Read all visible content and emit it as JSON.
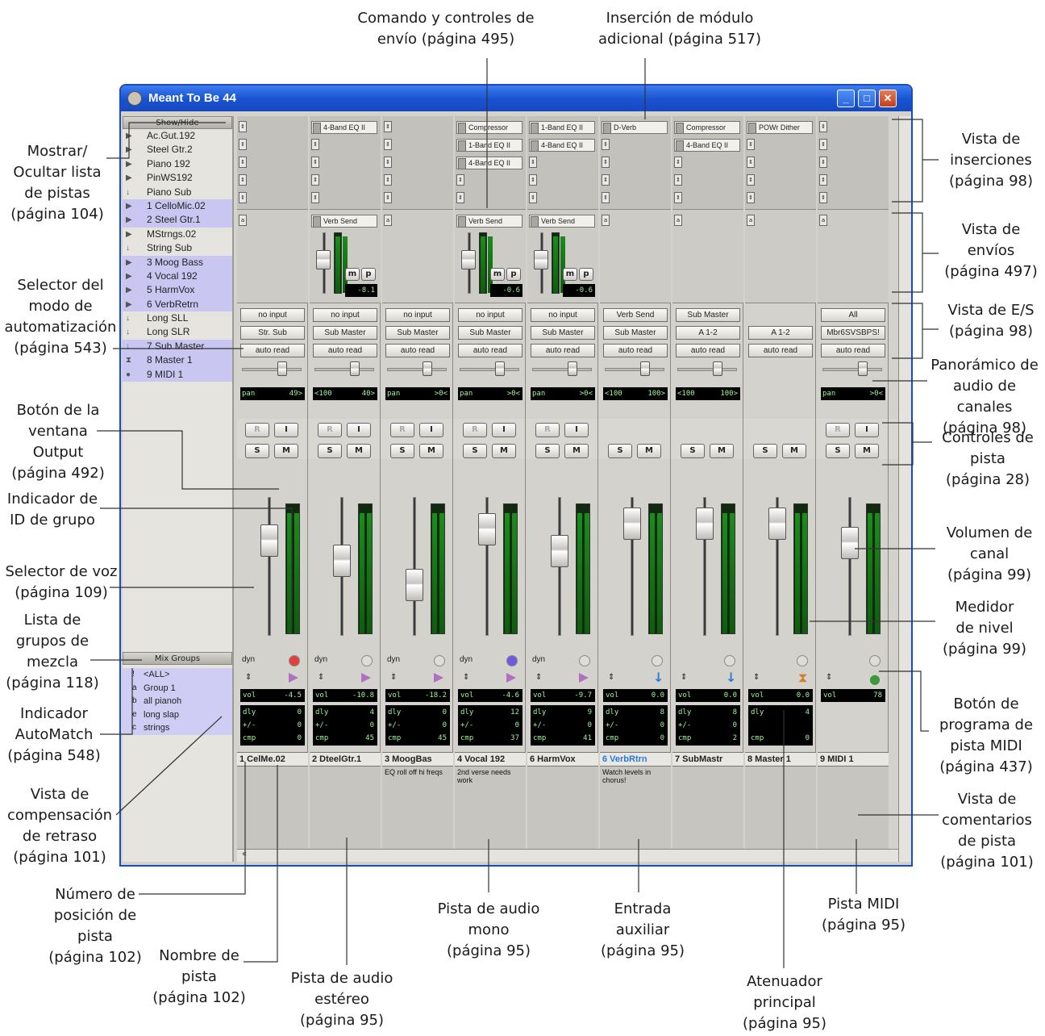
{
  "window": {
    "title": "Meant To Be 44"
  },
  "left_panel": {
    "show_hide_label": "Show/Hide",
    "tracks": [
      {
        "icon": "triangle",
        "name": "Ac.Gut.192",
        "selected": false
      },
      {
        "icon": "triangle",
        "name": "Steel Gtr.2",
        "selected": false
      },
      {
        "icon": "triangle",
        "name": "Piano 192",
        "selected": false
      },
      {
        "icon": "triangle",
        "name": "PinWS192",
        "selected": false
      },
      {
        "icon": "arrow",
        "name": "Piano Sub",
        "selected": false
      },
      {
        "icon": "triangle",
        "name": "1 CelloMic.02",
        "selected": true
      },
      {
        "icon": "triangle",
        "name": "2 Steel Gtr.1",
        "selected": true
      },
      {
        "icon": "triangle",
        "name": "MStrngs.02",
        "selected": false
      },
      {
        "icon": "arrow",
        "name": "String Sub",
        "selected": false
      },
      {
        "icon": "triangle",
        "name": "3 Moog Bass",
        "selected": true
      },
      {
        "icon": "triangle",
        "name": "4 Vocal 192",
        "selected": true
      },
      {
        "icon": "triangle",
        "name": "5 HarmVox",
        "selected": true
      },
      {
        "icon": "triangle",
        "name": "6 VerbRetrn",
        "selected": true
      },
      {
        "icon": "arrow",
        "name": "Long SLL",
        "selected": false
      },
      {
        "icon": "arrow",
        "name": "Long SLR",
        "selected": false
      },
      {
        "icon": "arrow",
        "name": "7 Sub Master",
        "selected": true
      },
      {
        "icon": "master",
        "name": "8 Master 1",
        "selected": true
      },
      {
        "icon": "midi",
        "name": "9 MIDI 1",
        "selected": true
      }
    ],
    "mix_groups_label": "Mix Groups",
    "groups": [
      {
        "letter": "!",
        "name": "<ALL>"
      },
      {
        "letter": "a",
        "name": "Group 1"
      },
      {
        "letter": "b",
        "name": "all pianoh"
      },
      {
        "letter": "e",
        "name": "long slap"
      },
      {
        "letter": "c",
        "name": "strings"
      }
    ]
  },
  "strips": [
    {
      "name": "1 CelMe.02",
      "inserts": [],
      "send": "",
      "send_value": "",
      "input": "no input",
      "output": "Str. Sub",
      "auto": "auto read",
      "pan_l": "pan",
      "pan_r": "49>",
      "rec": true,
      "vol": "-4.5",
      "dly": "0",
      "comp": "0",
      "cmp": "0",
      "comment": "",
      "dyn": "dyn",
      "voice": "red",
      "group_flag": "flag",
      "fader_pos": 0.3,
      "meter": 0.93
    },
    {
      "name": "2 DteelGtr.1",
      "inserts": [
        "4-Band EQ II"
      ],
      "send": "Verb Send",
      "send_value": "-8.1",
      "input": "no input",
      "output": "Sub Master",
      "auto": "auto read",
      "pan_l": "<100",
      "pan_r": "40>",
      "rec": true,
      "vol": "-10.8",
      "dly": "4",
      "comp": "0",
      "cmp": "45",
      "comment": "",
      "dyn": "dyn",
      "voice": "grey",
      "group_flag": "flag",
      "fader_pos": 0.45,
      "meter": 0.93
    },
    {
      "name": "3 MoogBas",
      "inserts": [],
      "send": "",
      "send_value": "",
      "input": "no input",
      "output": "Sub Master",
      "auto": "auto read",
      "pan_l": "pan",
      "pan_r": ">0<",
      "rec": true,
      "vol": "-18.2",
      "dly": "0",
      "comp": "0",
      "cmp": "45",
      "comment": "EQ roll off hi freqs",
      "dyn": "dyn",
      "voice": "grey",
      "group_flag": "flag",
      "fader_pos": 0.62,
      "meter": 0.93
    },
    {
      "name": "4 Vocal 192",
      "inserts": [
        "Compressor",
        "1-Band EQ II",
        "4-Band EQ II"
      ],
      "send": "Verb Send",
      "send_value": "-0.6",
      "input": "no input",
      "output": "Sub Master",
      "auto": "auto read",
      "pan_l": "pan",
      "pan_r": ">0<",
      "rec": true,
      "vol": "-4.6",
      "dly": "12",
      "comp": "0",
      "cmp": "37",
      "comment": "2nd verse needs work",
      "dyn": "dyn",
      "voice": "purple",
      "group_flag": "flag",
      "fader_pos": 0.22,
      "meter": 0.93
    },
    {
      "name": "6 HarmVox",
      "inserts": [
        "1-Band EQ II",
        "4-Band EQ II"
      ],
      "send": "Verb Send",
      "send_value": "-0.6",
      "input": "no input",
      "output": "Sub Master",
      "auto": "auto read",
      "pan_l": "pan",
      "pan_r": ">0<",
      "rec": true,
      "vol": "-9.7",
      "dly": "9",
      "comp": "0",
      "cmp": "41",
      "comment": "",
      "dyn": "dyn",
      "voice": "grey",
      "group_flag": "flag",
      "fader_pos": 0.38,
      "meter": 0.93
    },
    {
      "name": "6 VerbRtrn",
      "inserts": [
        "D-Verb"
      ],
      "send": "",
      "send_value": "",
      "input": "Verb Send",
      "output": "Sub Master",
      "auto": "auto read",
      "pan_l": "<100",
      "pan_r": "100>",
      "rec": false,
      "vol": "0.0",
      "dly": "8",
      "comp": "0",
      "cmp": "0",
      "comment": "Watch levels in chorus!",
      "dyn": "",
      "voice": "grey",
      "group_flag": "arrow",
      "fader_pos": 0.18,
      "meter": 0.93
    },
    {
      "name": "7 SubMastr",
      "inserts": [
        "Compressor",
        "4-Band EQ II"
      ],
      "send": "",
      "send_value": "",
      "input": "Sub Master",
      "output": "A 1-2",
      "auto": "auto read",
      "pan_l": "<100",
      "pan_r": "100>",
      "rec": false,
      "vol": "0.0",
      "dly": "8",
      "comp": "0",
      "cmp": "2",
      "comment": "",
      "dyn": "",
      "voice": "grey",
      "group_flag": "arrow",
      "fader_pos": 0.18,
      "meter": 0.93
    },
    {
      "name": "8 Master 1",
      "inserts": [
        "POWr Dither"
      ],
      "send": "",
      "send_value": "",
      "input": "",
      "output": "A 1-2",
      "auto": "auto read",
      "pan_l": "",
      "pan_r": "",
      "rec": false,
      "vol": "0.0",
      "dly": "4",
      "comp": "",
      "cmp": "0",
      "comment": "",
      "dyn": "",
      "voice": "grey",
      "group_flag": "hourglass",
      "fader_pos": 0.18,
      "meter": 0.93
    },
    {
      "name": "9 MIDI 1",
      "inserts": [],
      "send": "",
      "send_value": "",
      "input": "All",
      "output": "Mbr6SVSBPS!",
      "auto": "auto read",
      "pan_l": "pan",
      "pan_r": ">0<",
      "rec": true,
      "vol": "78",
      "dly": "",
      "comp": "",
      "cmp": "",
      "comment": "",
      "dyn": "",
      "voice": "grey",
      "group_flag": "globe",
      "fader_pos": 0.32,
      "meter": 0.93
    }
  ],
  "labels": {
    "rec": "R",
    "input_btn": "I",
    "solo": "S",
    "mute": "M",
    "vol": "vol",
    "dly": "dly",
    "comp_sym": "+/-",
    "cmp": "cmp",
    "send_m": "m",
    "send_p": "p",
    "scroll_left": "«"
  },
  "annotations": {
    "send_cmd": "Comando y controles de\nenvío (página 495)",
    "plugin_ins": "Inserción de módulo\nadicional (página 517)",
    "show_hide": "Mostrar/\nOcultar lista\nde pistas\n(página 104)",
    "auto_mode": "Selector del\nmodo de\nautomatización\n(página 543)",
    "output_btn": "Botón de la\nventana Output\n(página 492)",
    "group_id": "Indicador de\nID de grupo",
    "voice_sel": "Selector de voz\n(página 109)",
    "mix_groups": "Lista de\ngrupos de\nmezcla\n(página 118)",
    "automatch": "Indicador\nAutoMatch\n(página 548)",
    "delay_comp": "Vista de\ncompensación\nde retraso\n(página 101)",
    "pos_number": "Número de\nposición de\npista\n(página 102)",
    "track_name": "Nombre de\npista\n(página 102)",
    "stereo_audio": "Pista de audio\nestéreo\n(página 95)",
    "mono_audio": "Pista de audio\nmono\n(página 95)",
    "aux_input": "Entrada\nauxiliar\n(página 95)",
    "master_fader": "Atenuador\nprincipal\n(página 95)",
    "midi_track": "Pista MIDI\n(página 95)",
    "inserts_view": "Vista de\ninserciones\n(página 98)",
    "sends_view": "Vista de\nenvíos\n(página 497)",
    "io_view": "Vista de E/S\n(página 98)",
    "pan": "Panorámico de\naudio de canales\n(página 98)",
    "track_controls": "Controles de\npista\n(página 28)",
    "channel_vol": "Volumen de\ncanal\n(página 99)",
    "level_meter": "Medidor\nde nivel\n(página 99)",
    "midi_prog": "Botón de\nprograma de\npista MIDI\n(página 437)",
    "comments_view": "Vista de\ncomentarios\nde pista\n(página 101)"
  },
  "colors": {
    "titlebar": "#1852cf",
    "selected_track": "#c9c6f2",
    "lcd_text": "#9ff79b",
    "aux_name": "#2a78d8"
  }
}
